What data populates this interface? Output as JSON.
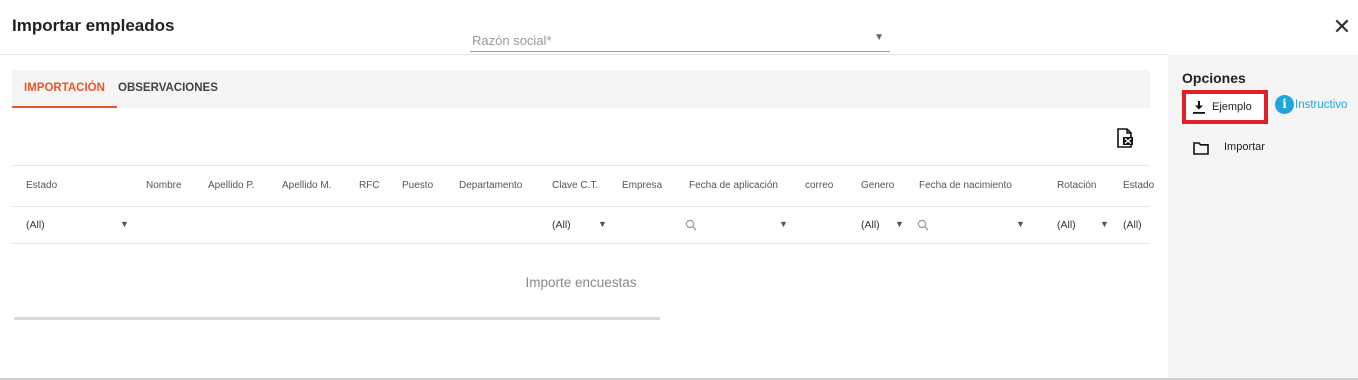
{
  "dialog": {
    "title": "Importar empleados",
    "close_glyph": "✕",
    "razon_social": {
      "placeholder": "Razón social*",
      "value": ""
    }
  },
  "tabs": [
    {
      "label": "IMPORTACIÓN",
      "active": true
    },
    {
      "label": "OBSERVACIONES",
      "active": false
    }
  ],
  "grid": {
    "columns": [
      "Estado",
      "Nombre",
      "Apellido P.",
      "Apellido M.",
      "RFC",
      "Puesto",
      "Departamento",
      "Clave C.T.",
      "Empresa",
      "Fecha de aplicación",
      "correo",
      "Genero",
      "Fecha de nacimiento",
      "Rotación",
      "Estado"
    ],
    "filters": {
      "estado": "(All)",
      "clave_ct": "(All)",
      "genero": "(All)",
      "rotacion": "(All)",
      "estado2": "(All)"
    },
    "empty_text": "Importe encuestas"
  },
  "options": {
    "title": "Opciones",
    "ejemplo_label": "Ejemplo",
    "instructivo_label": "Instructivo",
    "importar_label": "Importar"
  },
  "colors": {
    "accent": "#e8562a",
    "highlight": "#e01f26",
    "info": "#1ea6d8"
  }
}
